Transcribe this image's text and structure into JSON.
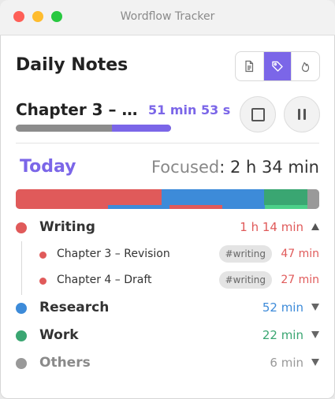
{
  "window": {
    "title": "Wordflow Tracker"
  },
  "header": {
    "title": "Daily Notes",
    "view_icons": [
      "document-icon",
      "tag-icon",
      "flame-icon"
    ],
    "active_view": "tag-icon"
  },
  "session": {
    "title": "Chapter 3 – …",
    "elapsed": "51 min 53 s",
    "progress_fraction": 0.38
  },
  "summary": {
    "period": "Today",
    "focused_label": "Focused",
    "separator": ":",
    "focused_value": "2 h 34 min"
  },
  "colors": {
    "accent": "#7b66e8",
    "writing": "#e05a5a",
    "research": "#3d8bd9",
    "work": "#3aa672",
    "others": "#999999",
    "progress_track": "#8c8c8c"
  },
  "categories": [
    {
      "name": "Writing",
      "duration": "1 h 14 min",
      "minutes": 74,
      "color": "#e05a5a",
      "expanded": true,
      "items": [
        {
          "name": "Chapter 3 – Revision",
          "tag": "#writing",
          "duration": "47 min",
          "minutes": 47
        },
        {
          "name": "Chapter 4 – Draft",
          "tag": "#writing",
          "duration": "27 min",
          "minutes": 27
        }
      ]
    },
    {
      "name": "Research",
      "duration": "52 min",
      "minutes": 52,
      "color": "#3d8bd9",
      "expanded": false
    },
    {
      "name": "Work",
      "duration": "22 min",
      "minutes": 22,
      "color": "#3aa672",
      "expanded": false
    },
    {
      "name": "Others",
      "duration": "6 min",
      "minutes": 6,
      "color": "#999999",
      "expanded": false
    }
  ]
}
